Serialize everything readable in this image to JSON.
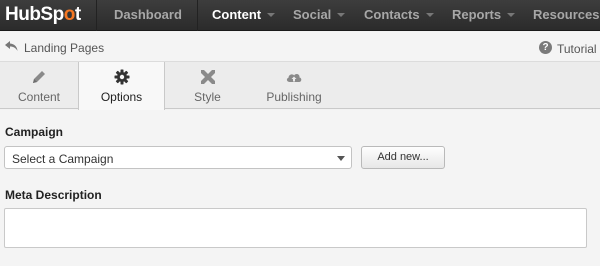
{
  "brand": {
    "logo_text": "HubSp",
    "logo_dot": "o",
    "logo_end": "t",
    "accent": "#f57722"
  },
  "nav": {
    "items": [
      {
        "label": "Dashboard"
      },
      {
        "label": "Content"
      },
      {
        "label": "Social"
      },
      {
        "label": "Contacts"
      },
      {
        "label": "Reports"
      },
      {
        "label": "Resources"
      }
    ],
    "active": "Content"
  },
  "breadcrumb": {
    "back_icon": "back-arrow-icon",
    "label": "Landing Pages"
  },
  "help": {
    "icon": "question-circle-icon",
    "glyph": "?",
    "label": "Tutorial"
  },
  "tabs": [
    {
      "label": "Content",
      "icon": "pencil-icon"
    },
    {
      "label": "Options",
      "icon": "gear-icon"
    },
    {
      "label": "Style",
      "icon": "brush-ruler-icon"
    },
    {
      "label": "Publishing",
      "icon": "cloud-upload-icon"
    }
  ],
  "active_tab": "Options",
  "form": {
    "campaign": {
      "label": "Campaign",
      "selected": "Select a Campaign",
      "add_button": "Add new..."
    },
    "meta": {
      "label": "Meta Description",
      "value": ""
    }
  }
}
